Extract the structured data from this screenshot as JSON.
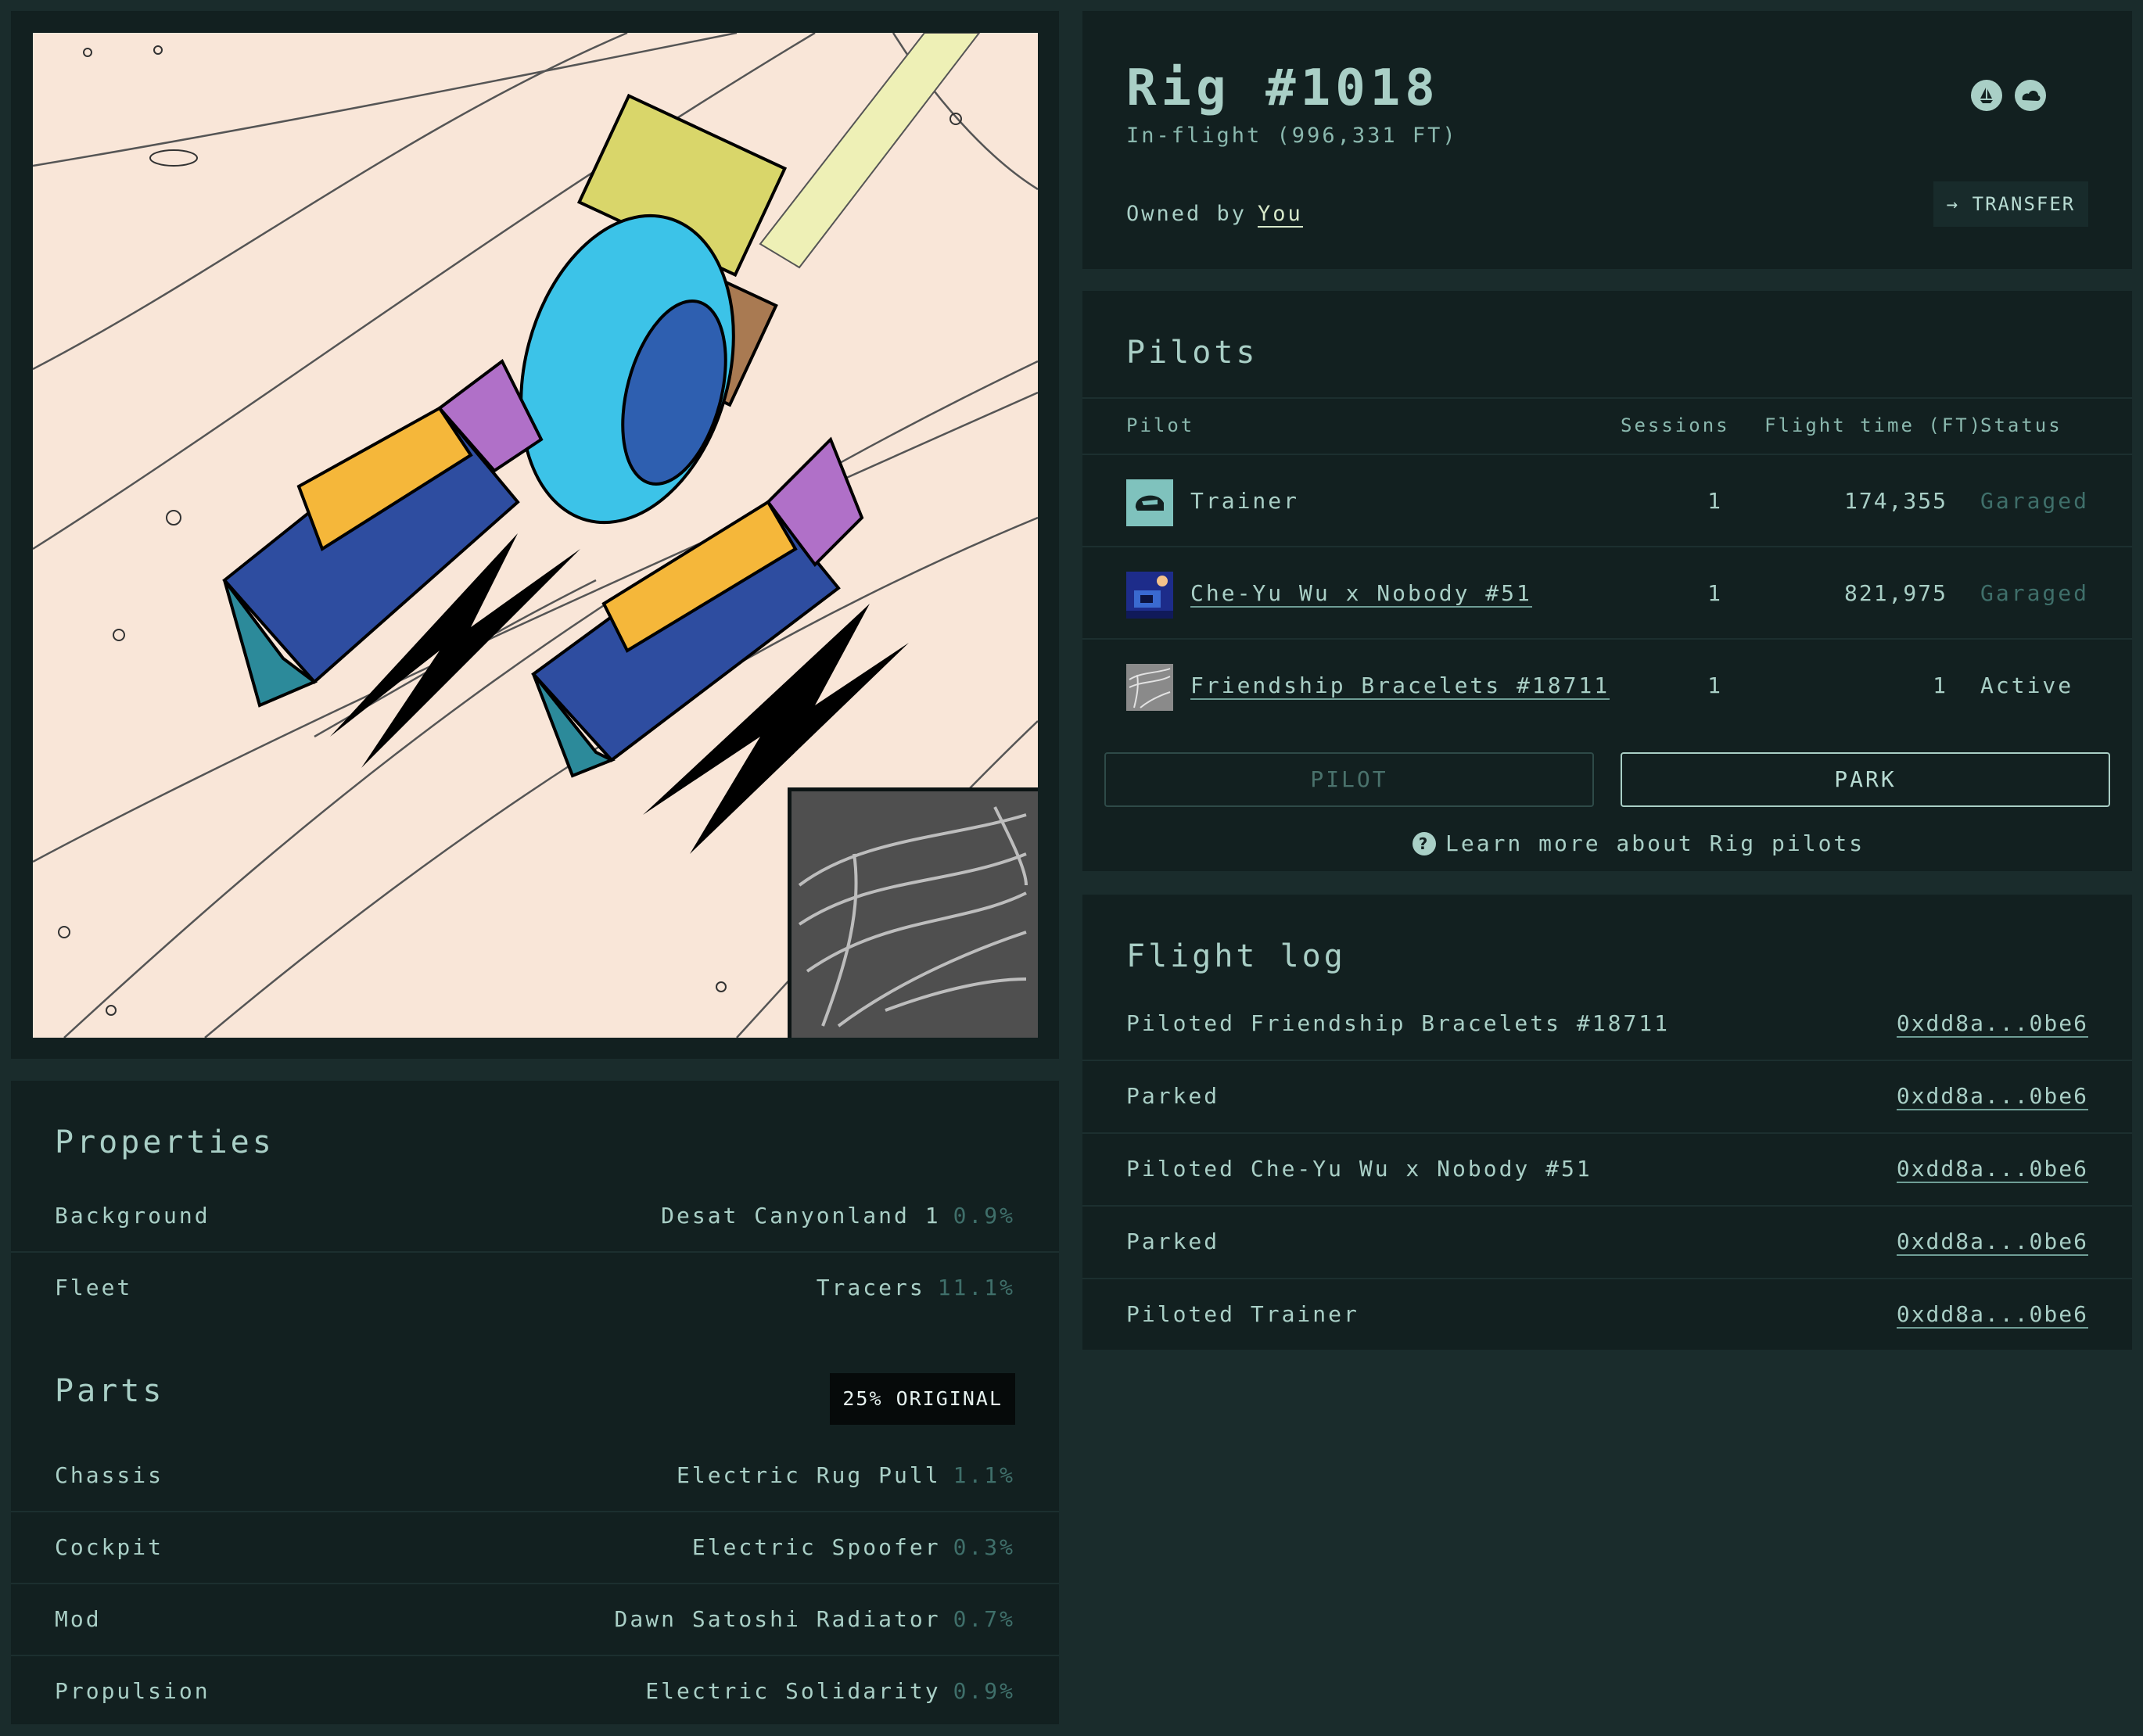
{
  "rig": {
    "title": "Rig #1018",
    "status": "In-flight (996,331 FT)",
    "owned_by_label": "Owned by",
    "owner": "You",
    "transfer_label": "→ TRANSFER",
    "header_icons": [
      "marketplace-icon",
      "cloud-icon"
    ]
  },
  "properties": {
    "title": "Properties",
    "items": [
      {
        "label": "Background",
        "value": "Desat Canyonland 1",
        "pct": "0.9%"
      },
      {
        "label": "Fleet",
        "value": "Tracers",
        "pct": "11.1%"
      }
    ]
  },
  "parts": {
    "title": "Parts",
    "badge": "25% ORIGINAL",
    "items": [
      {
        "label": "Chassis",
        "value": "Electric Rug Pull",
        "pct": "1.1%"
      },
      {
        "label": "Cockpit",
        "value": "Electric Spoofer",
        "pct": "0.3%"
      },
      {
        "label": "Mod",
        "value": "Dawn Satoshi Radiator",
        "pct": "0.7%"
      },
      {
        "label": "Propulsion",
        "value": "Electric Solidarity",
        "pct": "0.9%"
      }
    ]
  },
  "pilots": {
    "title": "Pilots",
    "columns": {
      "pilot": "Pilot",
      "sessions": "Sessions",
      "flight_time": "Flight time (FT)",
      "status": "Status"
    },
    "rows": [
      {
        "name": "Trainer",
        "sessions": "1",
        "flight_time": "174,355",
        "status": "Garaged",
        "status_color": "#3f6f6a"
      },
      {
        "name": "Che-Yu Wu x Nobody #51",
        "sessions": "1",
        "flight_time": "821,975",
        "status": "Garaged",
        "status_color": "#3f6f6a"
      },
      {
        "name": "Friendship Bracelets #18711",
        "sessions": "1",
        "flight_time": "1",
        "status": "Active",
        "status_color": "#a9cfc6"
      }
    ],
    "pilot_button": "PILOT",
    "park_button": "PARK",
    "learn_more": "Learn more about Rig pilots"
  },
  "flight_log": {
    "title": "Flight log",
    "entries": [
      {
        "event": "Piloted Friendship Bracelets #18711",
        "tx": "0xdd8a...0be6"
      },
      {
        "event": "Parked",
        "tx": "0xdd8a...0be6"
      },
      {
        "event": "Piloted Che-Yu Wu x Nobody #51",
        "tx": "0xdd8a...0be6"
      },
      {
        "event": "Parked",
        "tx": "0xdd8a...0be6"
      },
      {
        "event": "Piloted Trainer",
        "tx": "0xdd8a...0be6"
      }
    ]
  },
  "colors": {
    "page_bg": "#1a2c2c",
    "panel_bg": "#122020",
    "text": "#a9cfc6",
    "muted": "#3f6f6a",
    "art_bg": "#f9e6d8"
  }
}
